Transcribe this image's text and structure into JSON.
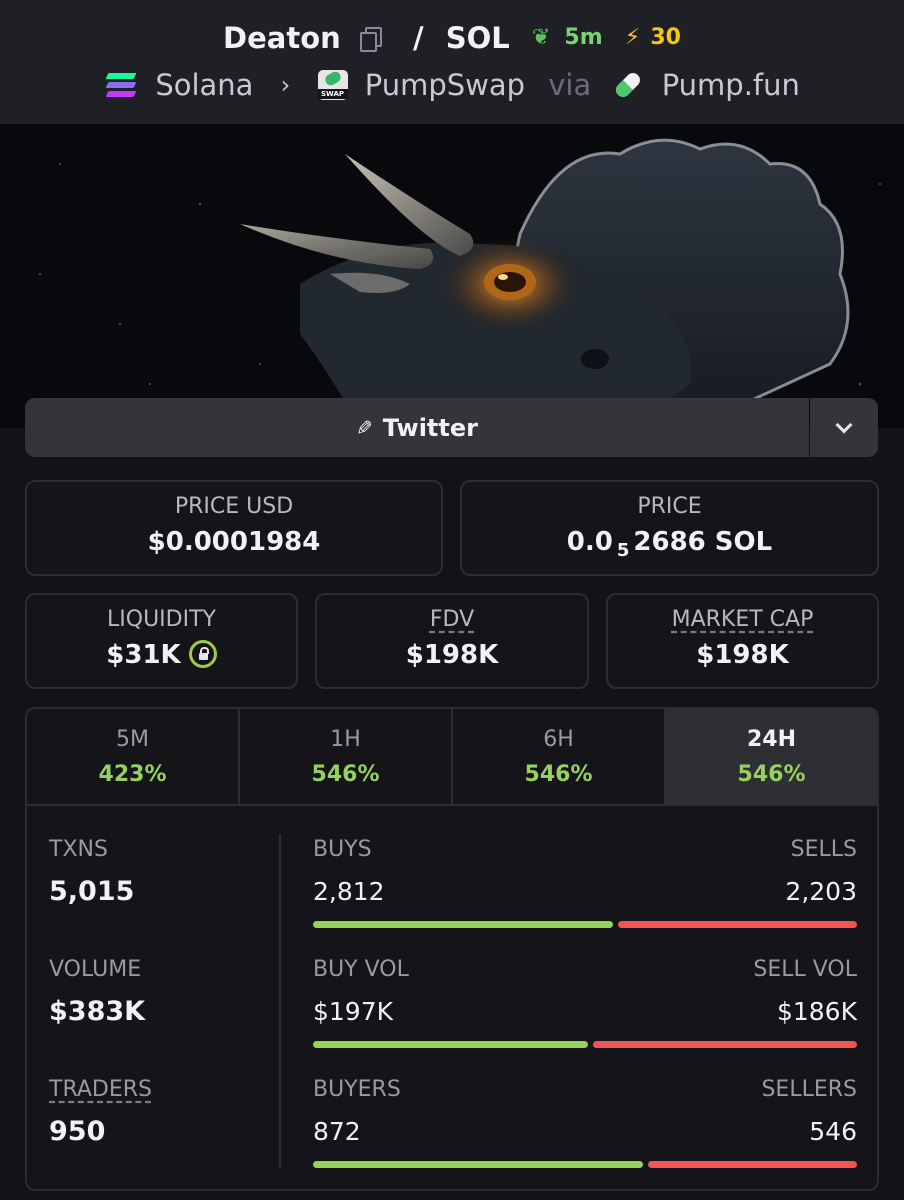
{
  "header": {
    "token": "Deaton",
    "separator": "/",
    "quote": "SOL",
    "age": "5m",
    "boost_symbol": "⚡",
    "boosts": "30",
    "chain": "Solana",
    "dex": "PumpSwap",
    "via": "via",
    "launchpad": "Pump.fun",
    "swap_icon_text": "SWAP"
  },
  "socials": {
    "twitter_label": "Twitter"
  },
  "stats": {
    "price_usd": {
      "label": "PRICE USD",
      "value": "$0.0001984"
    },
    "price": {
      "label": "PRICE",
      "prefix": "0.0",
      "zeros": "5",
      "suffix": "2686 SOL"
    },
    "liquidity": {
      "label": "LIQUIDITY",
      "value": "$31K"
    },
    "fdv": {
      "label": "FDV",
      "value": "$198K"
    },
    "market_cap": {
      "label": "MARKET CAP",
      "value": "$198K"
    }
  },
  "tabs": [
    {
      "label": "5M",
      "value": "423%"
    },
    {
      "label": "1H",
      "value": "546%"
    },
    {
      "label": "6H",
      "value": "546%"
    },
    {
      "label": "24H",
      "value": "546%",
      "active": true
    }
  ],
  "activity": {
    "txns": {
      "label": "TXNS",
      "value": "5,015"
    },
    "volume": {
      "label": "VOLUME",
      "value": "$383K"
    },
    "traders": {
      "label": "TRADERS",
      "value": "950"
    },
    "buys": {
      "label": "BUYS",
      "value": "2,812",
      "sell_label": "SELLS",
      "sell_value": "2,203",
      "buy_fraction": 0.561
    },
    "vol": {
      "label": "BUY VOL",
      "value": "$197K",
      "sell_label": "SELL VOL",
      "sell_value": "$186K",
      "buy_fraction": 0.514
    },
    "makers": {
      "label": "BUYERS",
      "value": "872",
      "sell_label": "SELLERS",
      "sell_value": "546",
      "buy_fraction": 0.615
    }
  },
  "colors": {
    "buy": "#96d160",
    "sell": "#f05454",
    "boost": "#f5c518",
    "age": "#79d46f"
  }
}
